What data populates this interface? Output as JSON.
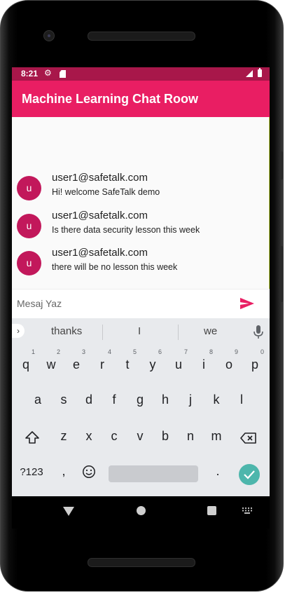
{
  "status": {
    "time": "8:21"
  },
  "app": {
    "title": "Machine Learning Chat Roow"
  },
  "messages": [
    {
      "avatar": "u",
      "sender": "user1@safetalk.com",
      "text": "Hi! welcome SafeTalk demo"
    },
    {
      "avatar": "u",
      "sender": "user1@safetalk.com",
      "text": "Is there data security lesson this week"
    },
    {
      "avatar": "u",
      "sender": "user1@safetalk.com",
      "text": "there will be no lesson this week"
    }
  ],
  "composer": {
    "placeholder": "Mesaj Yaz"
  },
  "keyboard": {
    "suggestions": [
      "thanks",
      "I",
      "we"
    ],
    "row1": [
      "q",
      "w",
      "e",
      "r",
      "t",
      "y",
      "u",
      "i",
      "o",
      "p"
    ],
    "row1_hints": [
      "1",
      "2",
      "3",
      "4",
      "5",
      "6",
      "7",
      "8",
      "9",
      "0"
    ],
    "row2": [
      "a",
      "s",
      "d",
      "f",
      "g",
      "h",
      "j",
      "k",
      "l"
    ],
    "row3": [
      "z",
      "x",
      "c",
      "v",
      "b",
      "n",
      "m"
    ],
    "symbols_label": "?123",
    "comma": ",",
    "period": "."
  },
  "colors": {
    "appbar": "#e91e63",
    "statusbar": "#a8174a",
    "avatar": "#c2185b",
    "send": "#e91e63",
    "enter": "#4db6ac"
  },
  "icons": {
    "settings": "gear-icon",
    "sdcard": "sd-card-icon",
    "signal": "signal-icon",
    "battery": "battery-icon",
    "send": "send-icon",
    "mic": "mic-icon",
    "shift": "shift-icon",
    "backspace": "backspace-icon",
    "emoji": "emoji-icon",
    "enter": "check-icon"
  }
}
